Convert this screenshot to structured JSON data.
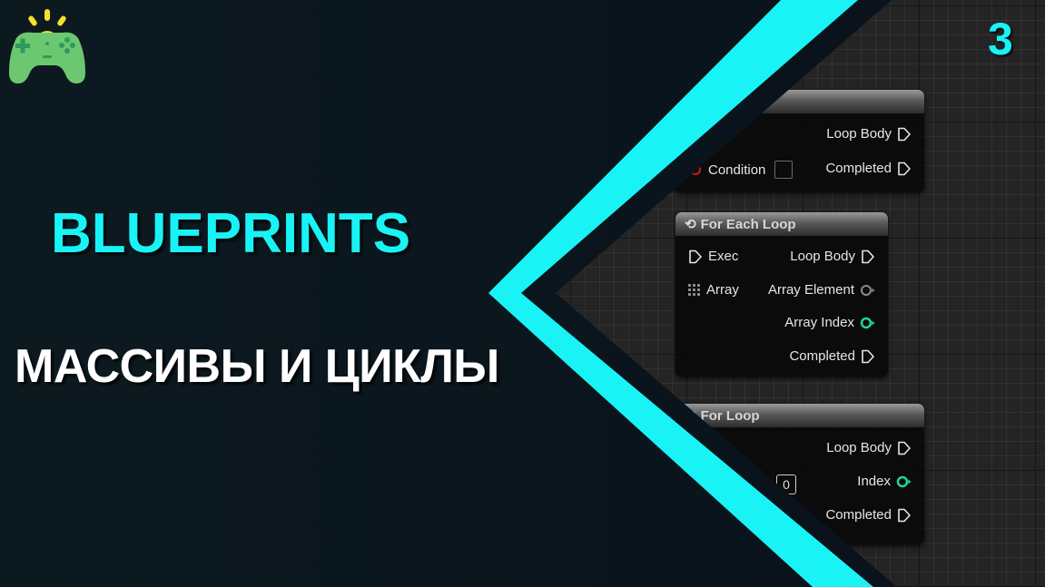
{
  "episode_number": "3",
  "headline": "BLUEPRINTS",
  "subheadline": "МАССИВЫ И ЦИКЛЫ",
  "logo": {
    "icon": "gamepad-icon",
    "colors": {
      "body": "#6cc870",
      "accent": "#f5e12a",
      "buttons": "#2f9a5e"
    }
  },
  "colors": {
    "accent_cyan": "#19f3f6",
    "background_dark": "#0b141c",
    "graph_grid": "#242424",
    "pin_int_green": "#1fd6a0",
    "pin_bool_red": "#b01919",
    "pin_wildcard_gray": "#8a8a8a"
  },
  "nodes": {
    "while_loop": {
      "title": "",
      "inputs": [
        {
          "label": "Condition",
          "type": "bool",
          "value": ""
        }
      ],
      "outputs": [
        {
          "label": "Loop Body",
          "type": "exec"
        },
        {
          "label": "Completed",
          "type": "exec"
        }
      ]
    },
    "for_each_loop": {
      "title": "For Each Loop",
      "icon": "loop-icon",
      "inputs": [
        {
          "label": "Exec",
          "type": "exec"
        },
        {
          "label": "Array",
          "type": "array"
        }
      ],
      "outputs": [
        {
          "label": "Loop Body",
          "type": "exec"
        },
        {
          "label": "Array Element",
          "type": "wildcard"
        },
        {
          "label": "Array Index",
          "type": "int"
        },
        {
          "label": "Completed",
          "type": "exec"
        }
      ]
    },
    "for_loop": {
      "title": "For Loop",
      "icon": "loop-icon",
      "inputs": [
        {
          "label": "",
          "type": "int",
          "value": "0"
        }
      ],
      "outputs": [
        {
          "label": "Loop Body",
          "type": "exec"
        },
        {
          "label": "Index",
          "type": "int"
        },
        {
          "label": "Completed",
          "type": "exec"
        }
      ]
    }
  }
}
